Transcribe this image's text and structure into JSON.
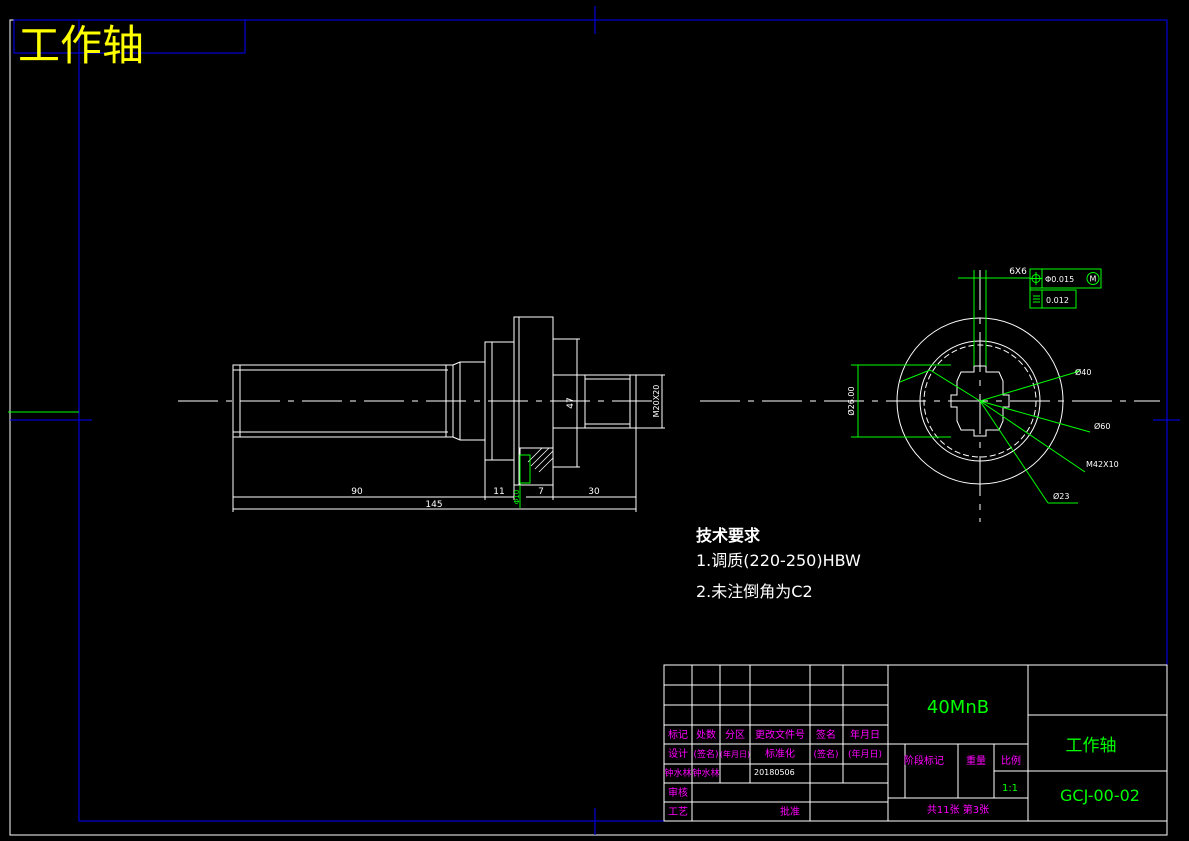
{
  "title": "工作轴",
  "dimensions": {
    "d90": "90",
    "d145": "145",
    "d11": "11",
    "d7": "7",
    "d30": "30",
    "d47": "47",
    "thread_right": "M20X20",
    "small_vert": "Φ10",
    "dia26": "Ø26.00",
    "dia40": "Ø40",
    "dia60": "Ø60",
    "thread_m42": "M42X10",
    "dia23": "Ø23",
    "spline": "6X6"
  },
  "tolerances": {
    "position_value": "Φ0.015",
    "position_modifier": "M",
    "flatness_value": "0.012"
  },
  "tech_requirements": {
    "heading": "技术要求",
    "item1": "1.调质(220-250)HBW",
    "item2": "2.未注倒角为C2"
  },
  "title_block": {
    "material": "40MnB",
    "part_name": "工作轴",
    "drawing_no": "GCJ-00-02",
    "scale": "1:1",
    "sheets": "共11张 第3张",
    "hdr_biaoji": "标记",
    "hdr_chushu": "处数",
    "hdr_fenqu": "分区",
    "hdr_genggai": "更改文件号",
    "hdr_qianming": "签名",
    "hdr_nianyueri": "年月日",
    "hdr_sheji": "设计",
    "hdr_qianming2": "(签名)",
    "hdr_nianyueri2": "(年月日)",
    "hdr_biaozhunhua": "标准化",
    "hdr_qianming3": "(签名)",
    "hdr_nianyueri3": "(年月日)",
    "designer": "钟水林",
    "designer2": "钟水林",
    "date": "20180506",
    "hdr_shenhe": "审核",
    "hdr_gongyi": "工艺",
    "hdr_pizhun": "批准",
    "hdr_jieduan": "阶段标记",
    "hdr_zhongliang": "重量",
    "hdr_bili": "比例"
  },
  "colors": {
    "background": "#000000",
    "frame": "#0000ff",
    "lines": "#ffffff",
    "dimension": "#00ff00",
    "title_text": "#ffff00",
    "table_text": "#ff00ff"
  }
}
